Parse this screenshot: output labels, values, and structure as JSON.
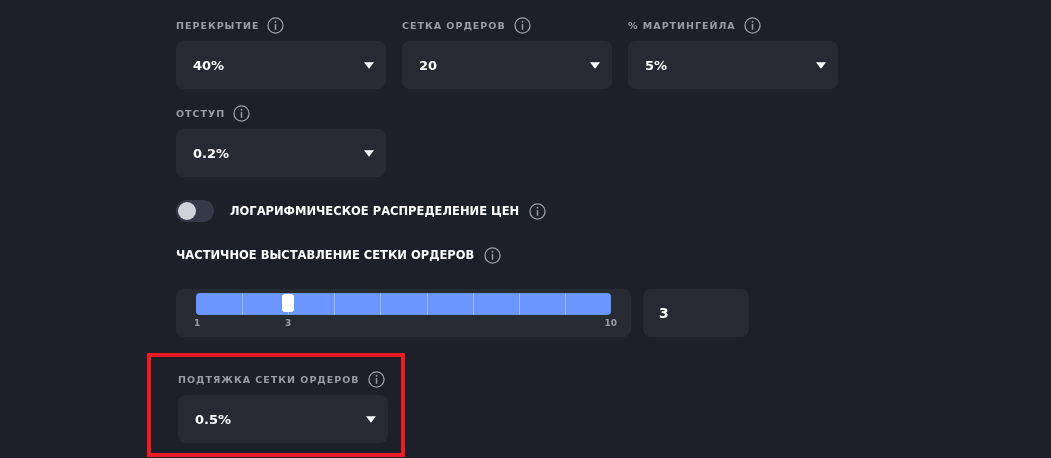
{
  "dropdown_rows": [
    [
      {
        "label": "ПЕРЕКРЫТИЕ",
        "value": "40%"
      },
      {
        "label": "СЕТКА ОРДЕРОВ",
        "value": "20"
      },
      {
        "label": "% МАРТИНГЕЙЛА",
        "value": "5%"
      }
    ],
    [
      {
        "label": "ОТСТУП",
        "value": "0.2%"
      }
    ]
  ],
  "toggle": {
    "label": "ЛОГАРИФМИЧЕСКОЕ РАСПРЕДЕЛЕНИЕ ЦЕН",
    "on": false
  },
  "partial": {
    "title": "ЧАСТИЧНОЕ ВЫСТАВЛЕНИЕ СЕТКИ ОРДЕРОВ",
    "slider": {
      "level": 0.222,
      "min_label": "1",
      "value_label": "3",
      "max_label": "10"
    },
    "input_value": "3"
  },
  "highlighted_field": {
    "label": "ПОДТЯЖКА СЕТКИ ОРДЕРОВ",
    "value": "0.5%",
    "highlighted": true
  }
}
